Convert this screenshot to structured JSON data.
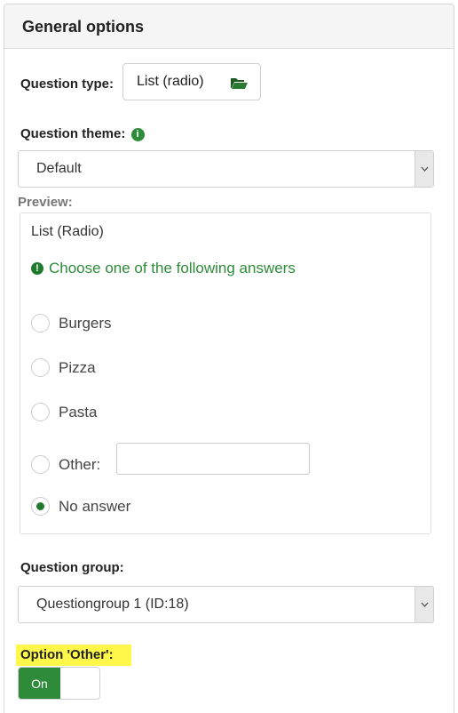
{
  "panel": {
    "title": "General options"
  },
  "question_type": {
    "label": "Question type:",
    "value": "List (radio)",
    "icon": "folder-open-icon"
  },
  "question_theme": {
    "label": "Question theme:",
    "info_icon": "info-icon",
    "value": "Default"
  },
  "preview": {
    "label": "Preview:",
    "title": "List (Radio)",
    "help_text": "Choose one of the following answers",
    "options": [
      "Burgers",
      "Pizza",
      "Pasta"
    ],
    "other_label": "Other:",
    "no_answer_label": "No answer",
    "accent_color": "#2e8b3a"
  },
  "question_group": {
    "label": "Question group:",
    "value": "Questiongroup 1 (ID:18)"
  },
  "option_other": {
    "label": "Option 'Other':",
    "toggle_on": "On",
    "highlight_color": "#fff84a"
  }
}
